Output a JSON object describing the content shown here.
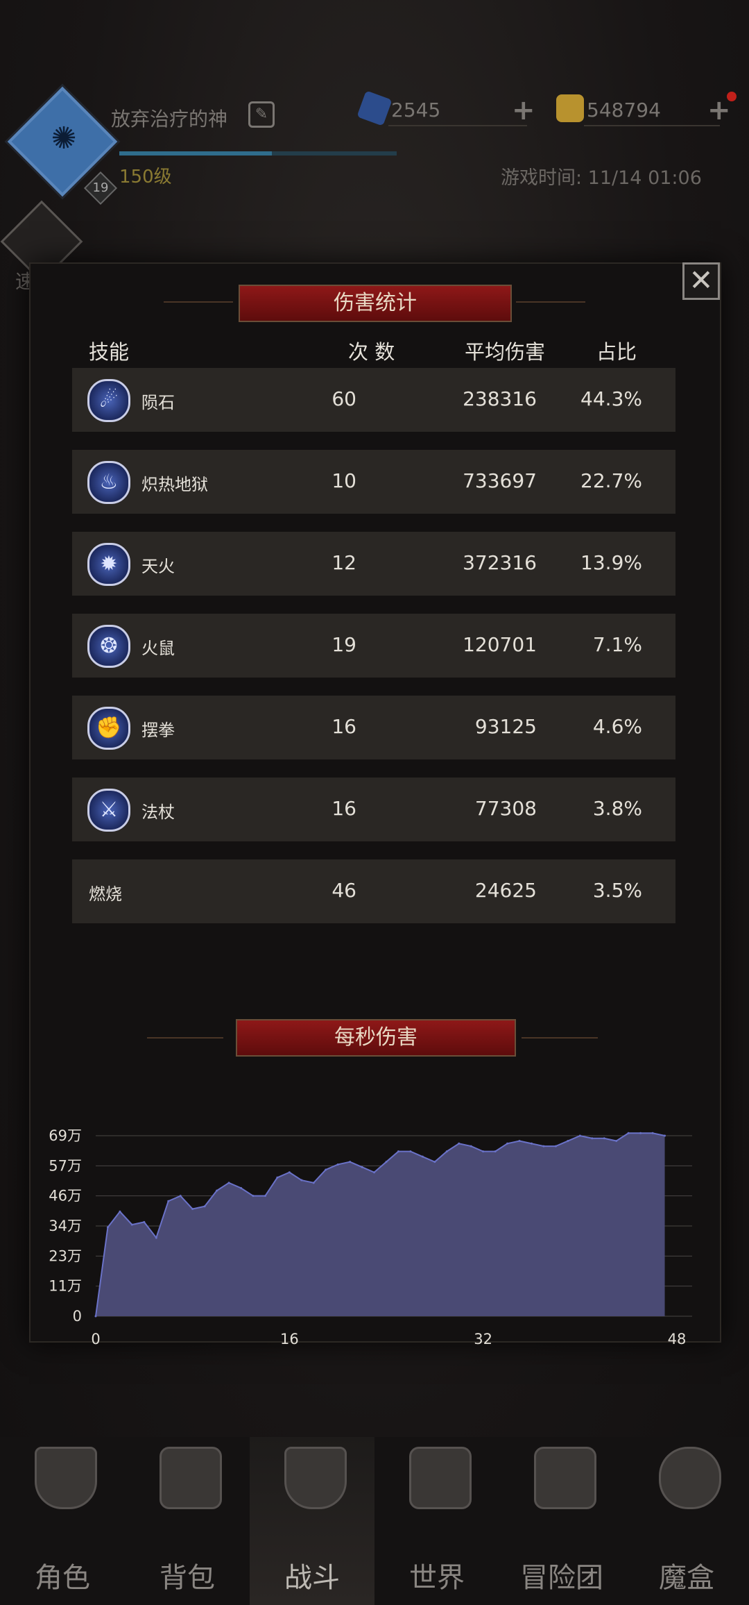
{
  "header": {
    "player_name": "放弃治疗的神",
    "level_label": "150级",
    "avatar_level": "19",
    "gem_count": "2545",
    "gold_count": "548794",
    "game_time": "游戏时间: 11/14 01:06",
    "speed_label": "速",
    "xp_progress_pct": 55
  },
  "modal": {
    "title": "伤害统计",
    "columns": {
      "skill": "技能",
      "count": "次 数",
      "avg": "平均伤害",
      "pct": "占比"
    },
    "rows": [
      {
        "name": "陨石",
        "count": "60",
        "avg": "238316",
        "pct": "44.3%",
        "icon": "meteor-icon"
      },
      {
        "name": "炽热地狱",
        "count": "10",
        "avg": "733697",
        "pct": "22.7%",
        "icon": "inferno-icon"
      },
      {
        "name": "天火",
        "count": "12",
        "avg": "372316",
        "pct": "13.9%",
        "icon": "sky-fire-icon"
      },
      {
        "name": "火鼠",
        "count": "19",
        "avg": "120701",
        "pct": "7.1%",
        "icon": "fire-rat-icon"
      },
      {
        "name": "摆拳",
        "count": "16",
        "avg": "93125",
        "pct": "4.6%",
        "icon": "swing-punch-icon"
      },
      {
        "name": "法杖",
        "count": "16",
        "avg": "77308",
        "pct": "3.8%",
        "icon": "staff-icon"
      },
      {
        "name": "燃烧",
        "count": "46",
        "avg": "24625",
        "pct": "3.5%",
        "icon": ""
      }
    ],
    "dps_title": "每秒伤害",
    "close_label": "✕"
  },
  "chart_data": {
    "type": "area",
    "y_tick_labels": [
      "0",
      "11万",
      "23万",
      "34万",
      "46万",
      "57万",
      "69万"
    ],
    "x_tick_labels": [
      "0",
      "16",
      "32",
      "48"
    ],
    "ylim": [
      0,
      69
    ],
    "xlim": [
      0,
      48
    ],
    "x": [
      0,
      1,
      2,
      3,
      4,
      5,
      6,
      7,
      8,
      9,
      10,
      11,
      12,
      13,
      14,
      15,
      16,
      17,
      18,
      19,
      20,
      21,
      22,
      23,
      24,
      25,
      26,
      27,
      28,
      29,
      30,
      31,
      32,
      33,
      34,
      35,
      36,
      37,
      38,
      39,
      40,
      41,
      42,
      43,
      44,
      45,
      46,
      47
    ],
    "values": [
      0,
      34,
      40,
      35,
      36,
      30,
      44,
      46,
      41,
      42,
      48,
      51,
      49,
      46,
      46,
      53,
      55,
      52,
      51,
      56,
      58,
      59,
      57,
      55,
      59,
      63,
      63,
      61,
      59,
      63,
      66,
      65,
      63,
      63,
      66,
      67,
      66,
      65,
      65,
      67,
      69,
      68,
      68,
      67,
      70,
      70,
      70,
      69
    ],
    "fill_color": "#4a4a74",
    "line_color": "#6a72c8"
  },
  "nav": {
    "items": [
      {
        "label": "角色",
        "icon": "helmet-icon"
      },
      {
        "label": "背包",
        "icon": "backpack-icon"
      },
      {
        "label": "战斗",
        "icon": "sword-shield-icon"
      },
      {
        "label": "世界",
        "icon": "map-scroll-icon"
      },
      {
        "label": "冒险团",
        "icon": "castle-icon"
      },
      {
        "label": "魔盒",
        "icon": "magic-box-icon"
      }
    ]
  }
}
